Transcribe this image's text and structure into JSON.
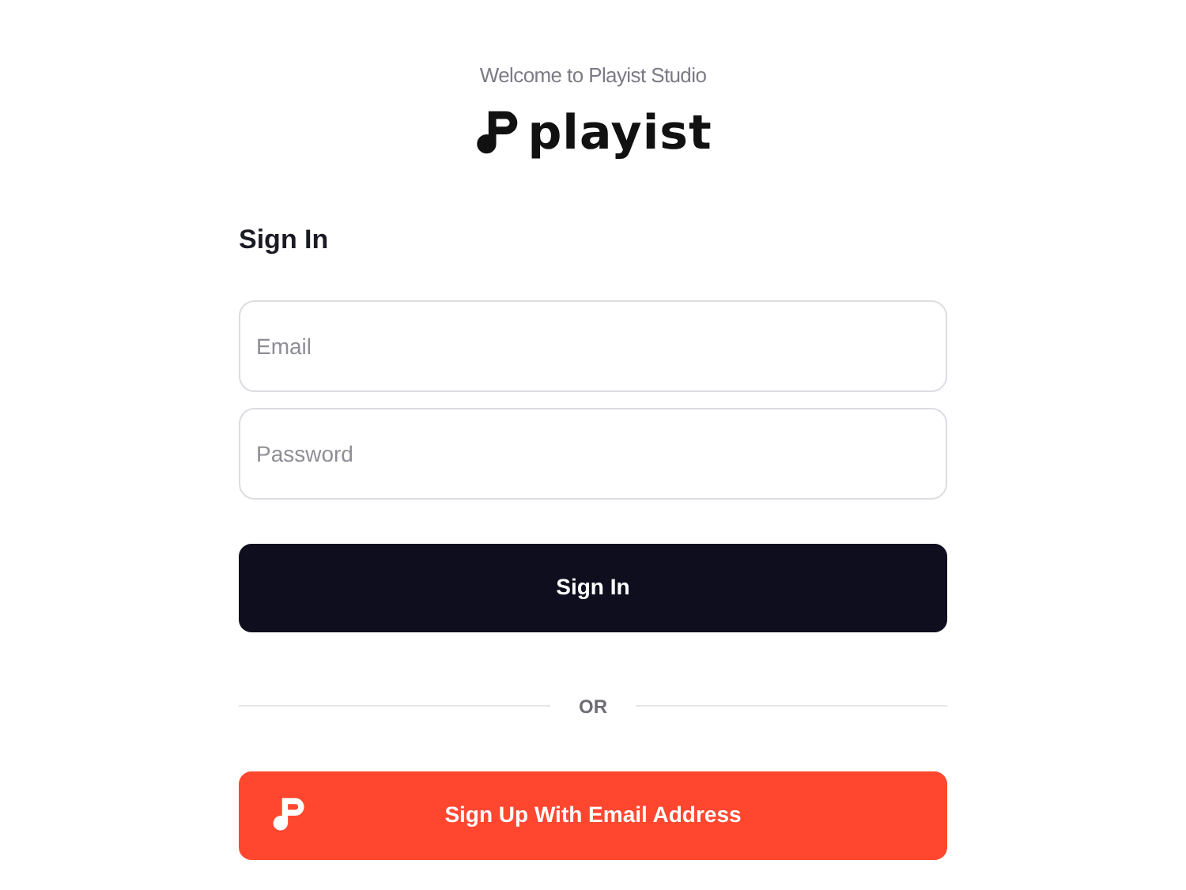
{
  "welcome": "Welcome to Playist Studio",
  "logo": {
    "text": "playist"
  },
  "heading": "Sign In",
  "fields": [
    {
      "placeholder": "Email"
    },
    {
      "placeholder": "Password"
    }
  ],
  "sign_in_button": "Sign In",
  "divider": "OR",
  "signup_button": "Sign Up With Email Address"
}
